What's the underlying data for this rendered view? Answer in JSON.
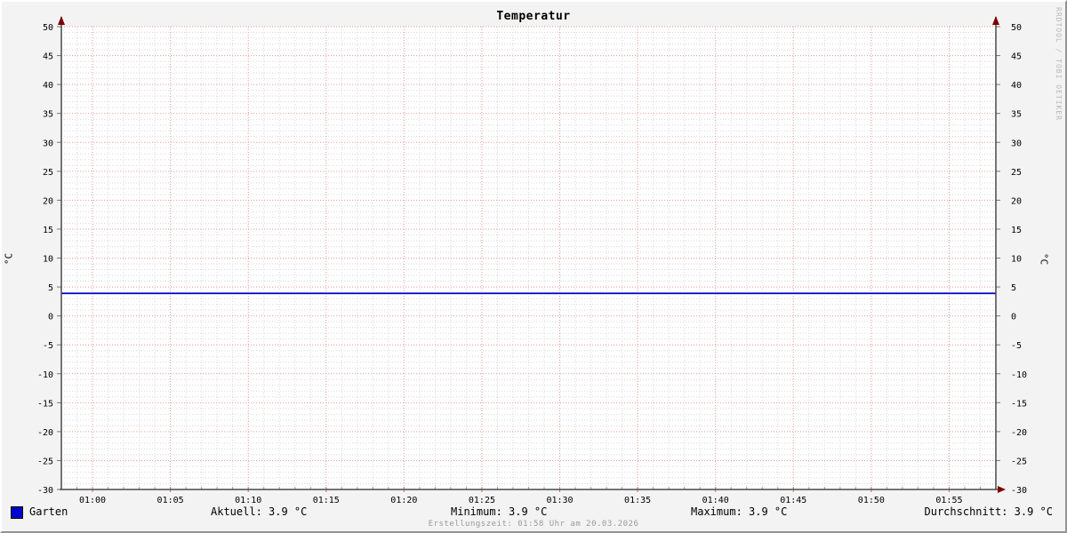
{
  "title": "Temperatur",
  "branding_vertical": "RRDTOOL / TOBI OETIKER",
  "axes": {
    "left_unit": "°C",
    "right_unit": "°C"
  },
  "legend": {
    "series_label": "Garten",
    "series_color": "#0000cc"
  },
  "stats_line": {
    "aktuell": "Aktuell: 3.9 °C",
    "minimum": "Minimum: 3.9 °C",
    "maximum": "Maximum: 3.9 °C",
    "durchschnitt": "Durchschnitt: 3.9 °C"
  },
  "footer": {
    "creation_time": "Erstellungszeit: 01:58 Uhr am 20.03.2026"
  },
  "chart_data": {
    "type": "line",
    "title": "Temperatur",
    "ylabel": "°C",
    "ylim": [
      -30,
      50
    ],
    "y_major_step": 5,
    "y_minor_step": 1,
    "x_start": "00:58",
    "x_end": "01:58",
    "x_total_minutes": 60,
    "x_first_tick_offset_min": 2,
    "x_tick_step_min": 5,
    "x_minor_step_min": 1,
    "x_tick_labels": [
      "01:00",
      "01:05",
      "01:10",
      "01:15",
      "01:20",
      "01:25",
      "01:30",
      "01:35",
      "01:40",
      "01:45",
      "01:50",
      "01:55"
    ],
    "series": [
      {
        "name": "Garten",
        "color": "#0000cc",
        "constant_value": 3.9
      }
    ],
    "stats": {
      "aktuell": 3.9,
      "minimum": 3.9,
      "maximum": 3.9,
      "durchschnitt": 3.9,
      "unit": "°C"
    },
    "grid": {
      "on": true,
      "major_color": "#e59a9a",
      "minor_color": "#d9d9d9",
      "axis_color": "#4a4a4a",
      "arrow_color": "#7d0000",
      "tick_label_color": "#000000"
    },
    "legend_position": "bottom"
  }
}
